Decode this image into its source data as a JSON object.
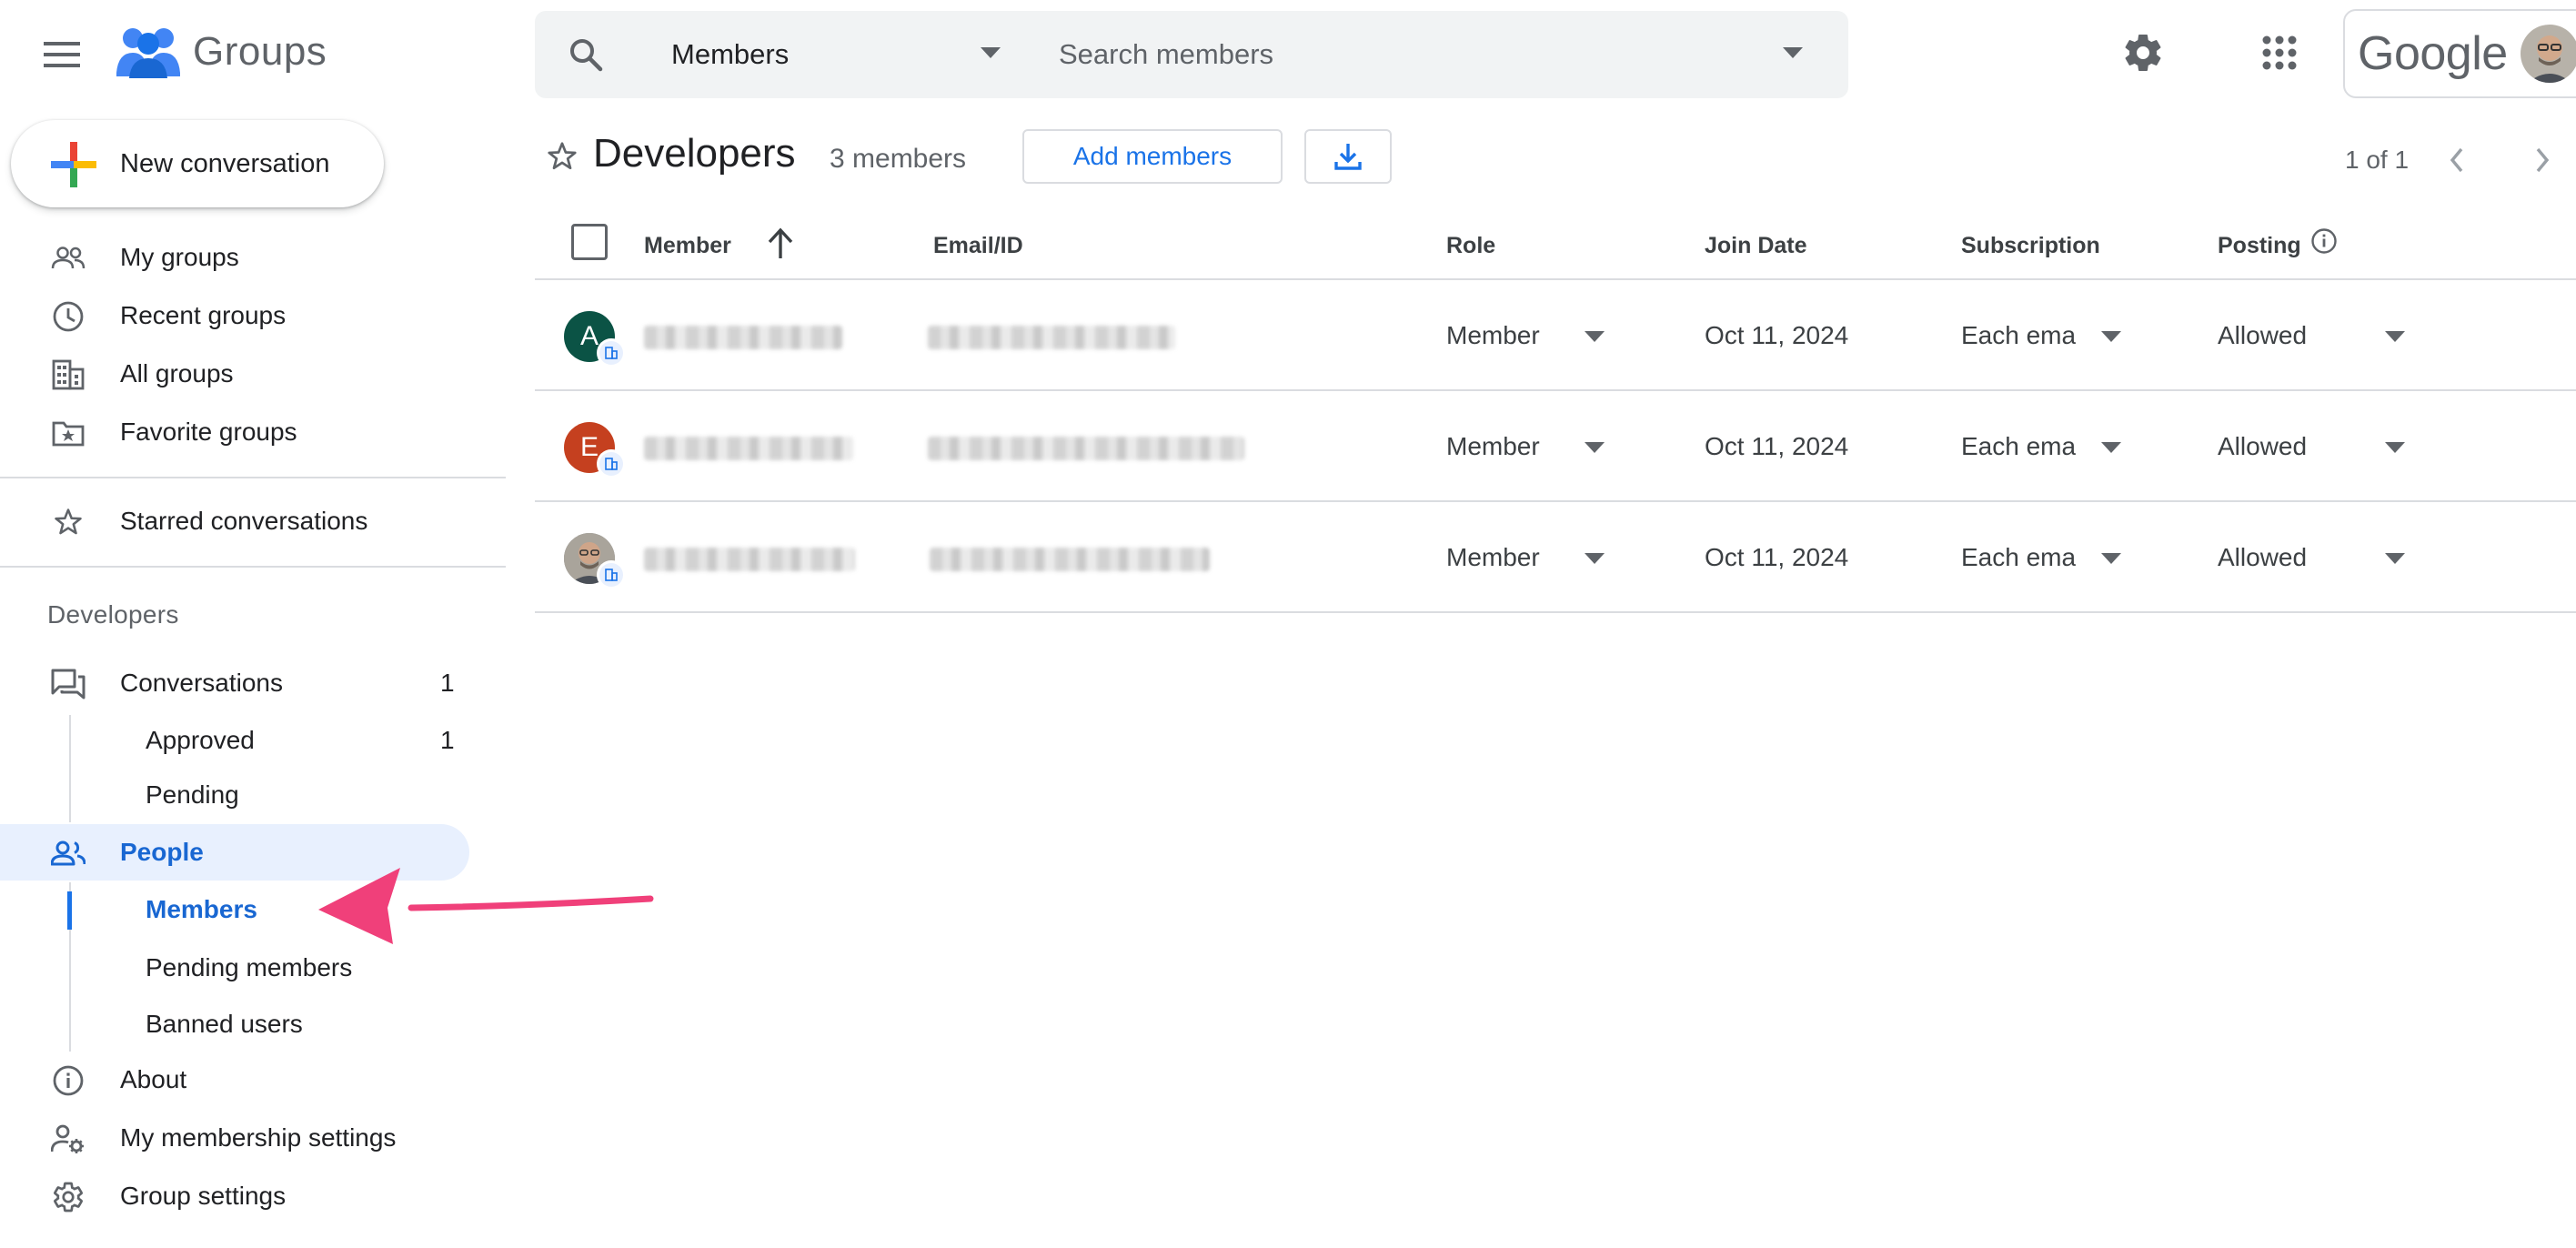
{
  "app": {
    "name": "Groups",
    "google_wordmark": "Google"
  },
  "search": {
    "scope": "Members",
    "placeholder": "Search members"
  },
  "sidebar": {
    "new_conversation": "New conversation",
    "top_items": [
      {
        "label": "My groups",
        "icon": "people-outline-icon"
      },
      {
        "label": "Recent groups",
        "icon": "clock-icon"
      },
      {
        "label": "All groups",
        "icon": "building-icon"
      },
      {
        "label": "Favorite groups",
        "icon": "folder-star-icon"
      }
    ],
    "starred": "Starred conversations",
    "group_section": "Developers",
    "conversations": {
      "label": "Conversations",
      "count": "1"
    },
    "conversation_subitems": [
      {
        "label": "Approved",
        "count": "1"
      },
      {
        "label": "Pending",
        "count": ""
      }
    ],
    "people": "People",
    "people_subitems": [
      {
        "label": "Members",
        "active": true
      },
      {
        "label": "Pending members"
      },
      {
        "label": "Banned users"
      }
    ],
    "bottom_items": [
      {
        "label": "About",
        "icon": "info-icon"
      },
      {
        "label": "My membership settings",
        "icon": "person-gear-icon"
      },
      {
        "label": "Group settings",
        "icon": "gear-icon"
      }
    ]
  },
  "main": {
    "group_title": "Developers",
    "member_count": "3 members",
    "add_members": "Add members",
    "pagination": "1 of 1",
    "columns": {
      "member": "Member",
      "email": "Email/ID",
      "role": "Role",
      "join_date": "Join Date",
      "subscription": "Subscription",
      "posting": "Posting"
    },
    "rows": [
      {
        "initial": "A",
        "avatar_color": "#0b5345",
        "role": "Member",
        "join_date": "Oct 11, 2024",
        "subscription": "Each ema",
        "posting": "Allowed"
      },
      {
        "initial": "E",
        "avatar_color": "#c5401f",
        "role": "Member",
        "join_date": "Oct 11, 2024",
        "subscription": "Each ema",
        "posting": "Allowed"
      },
      {
        "initial": "",
        "avatar_color": "#8a8f94",
        "role": "Member",
        "join_date": "Oct 11, 2024",
        "subscription": "Each ema",
        "posting": "Allowed"
      }
    ]
  },
  "colors": {
    "accent_blue": "#1a73e8",
    "active_bg": "#e8f0fe",
    "annotation_arrow": "#f0407a"
  }
}
